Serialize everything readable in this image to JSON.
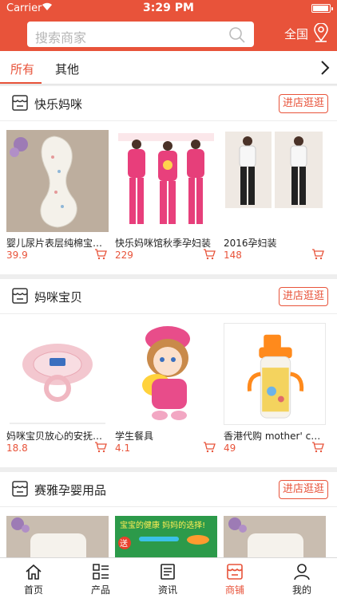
{
  "status_bar": {
    "carrier": "Carrier",
    "time": "3:29 PM"
  },
  "header": {
    "search_placeholder": "搜索商家",
    "region": "全国"
  },
  "tabs": [
    {
      "label": "所有"
    },
    {
      "label": "其他"
    }
  ],
  "shops": [
    {
      "name": "快乐妈咪",
      "visit_label": "进店逛逛",
      "products": [
        {
          "name": "婴儿尿片表层纯棉宝宝尿布",
          "price": "39.9"
        },
        {
          "name": "快乐妈咪馆秋季孕妇装",
          "price": "229"
        },
        {
          "name": "2016孕妇装",
          "price": "148"
        }
      ]
    },
    {
      "name": "妈咪宝贝",
      "visit_label": "进店逛逛",
      "products": [
        {
          "name": "妈咪宝贝放心的安抚奶嘴",
          "price": "18.8"
        },
        {
          "name": "学生餐具",
          "price": "4.1"
        },
        {
          "name": "香港代购 mother' corn",
          "price": "49"
        }
      ]
    },
    {
      "name": "赛雅孕婴用品",
      "visit_label": "进店逛逛",
      "products": [
        {
          "name": "",
          "price": ""
        },
        {
          "name": "",
          "price": "",
          "banner_text": "宝宝的健康 妈妈的选择!",
          "banner_small": "送"
        },
        {
          "name": "",
          "price": ""
        }
      ]
    }
  ],
  "tabbar": [
    {
      "label": "首页",
      "icon": "home-icon"
    },
    {
      "label": "产品",
      "icon": "grid-icon"
    },
    {
      "label": "资讯",
      "icon": "news-icon"
    },
    {
      "label": "商铺",
      "icon": "store-icon"
    },
    {
      "label": "我的",
      "icon": "user-icon"
    }
  ],
  "colors": {
    "accent": "#e8533a"
  }
}
